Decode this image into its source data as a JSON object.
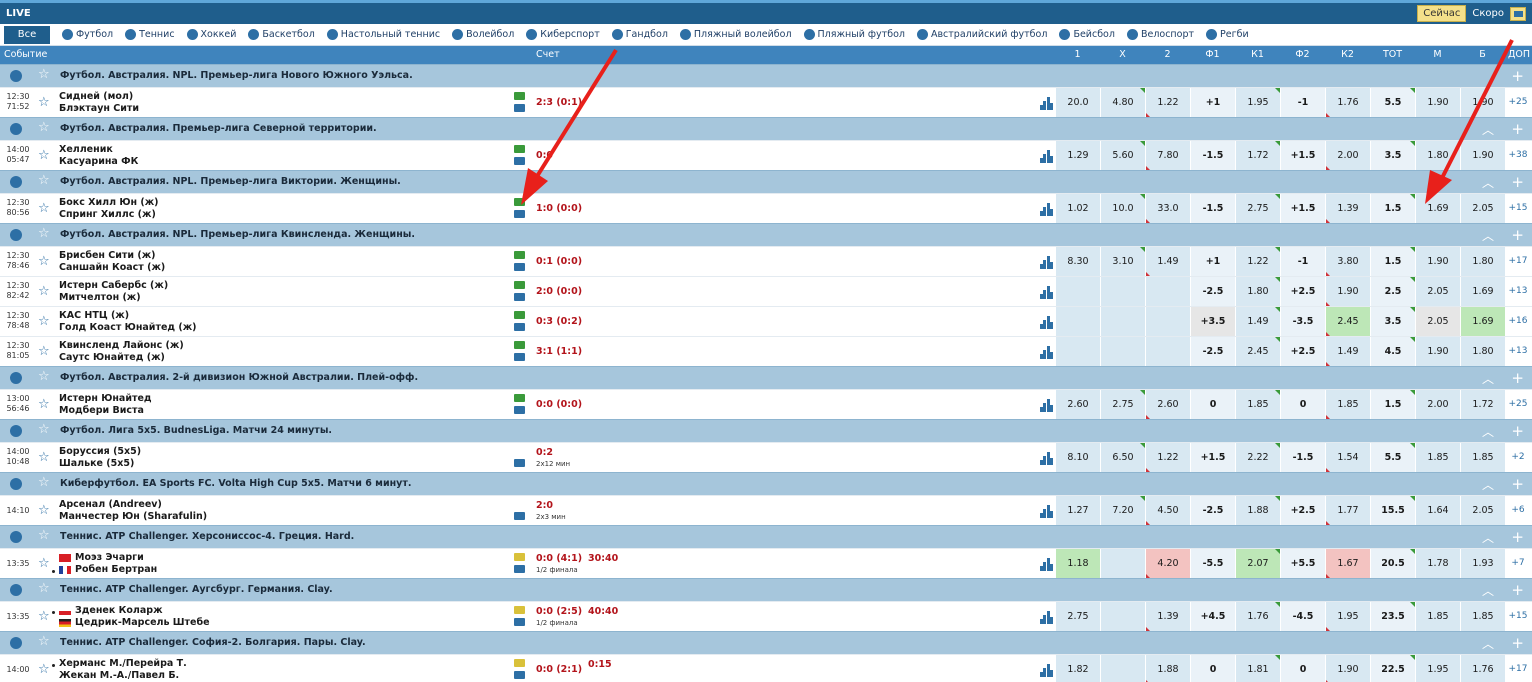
{
  "topbar": {
    "live": "LIVE",
    "now": "Сейчас",
    "soon": "Скоро"
  },
  "sports": {
    "all": "Все",
    "items": [
      "Футбол",
      "Теннис",
      "Хоккей",
      "Баскетбол",
      "Настольный теннис",
      "Волейбол",
      "Киберспорт",
      "Гандбол",
      "Пляжный волейбол",
      "Пляжный футбол",
      "Австралийский футбол",
      "Бейсбол",
      "Велоспорт",
      "Регби"
    ]
  },
  "header": {
    "event": "Событие",
    "score": "Счет",
    "c1": "1",
    "cx": "X",
    "c2": "2",
    "f1": "Ф1",
    "k1": "К1",
    "f2": "Ф2",
    "k2": "К2",
    "tot": "ТОТ",
    "m": "М",
    "b": "Б",
    "dop": "ДОП"
  },
  "colors": {
    "accent": "#1f5e8c",
    "score": "#b3141b",
    "league": "#a6c6dc",
    "arrow": "#e8201b"
  },
  "leagues": [
    {
      "name": "Футбол. Австралия. NPL. Премьер-лига Нового Южного Уэльса.",
      "rows": [
        {
          "t": "12:30",
          "m": "71:52",
          "a": "Сидней (мол)",
          "b": "Блэктаун Сити",
          "sc": "2:3 (0:1)",
          "odds": [
            "20.0",
            "4.80",
            "1.22",
            "+1",
            "1.95",
            "-1",
            "1.76",
            "5.5",
            "1.90",
            "1.90"
          ],
          "more": "+25"
        }
      ]
    },
    {
      "name": "Футбол. Австралия. Премьер-лига Северной территории.",
      "rows": [
        {
          "t": "14:00",
          "m": "05:47",
          "a": "Хелленик",
          "b": "Касуарина ФК",
          "sc": "0:0",
          "odds": [
            "1.29",
            "5.60",
            "7.80",
            "-1.5",
            "1.72",
            "+1.5",
            "2.00",
            "3.5",
            "1.80",
            "1.90"
          ],
          "more": "+38"
        }
      ]
    },
    {
      "name": "Футбол. Австралия. NPL. Премьер-лига Виктории. Женщины.",
      "rows": [
        {
          "t": "12:30",
          "m": "80:56",
          "a": "Бокс Хилл Юн (ж)",
          "b": "Спринг Хиллс (ж)",
          "sc": "1:0 (0:0)",
          "odds": [
            "1.02",
            "10.0",
            "33.0",
            "-1.5",
            "2.75",
            "+1.5",
            "1.39",
            "1.5",
            "1.69",
            "2.05"
          ],
          "more": "+15"
        }
      ]
    },
    {
      "name": "Футбол. Австралия. NPL. Премьер-лига Квинсленда. Женщины.",
      "rows": [
        {
          "t": "12:30",
          "m": "78:46",
          "a": "Брисбен Сити (ж)",
          "b": "Саншайн Коаст (ж)",
          "sc": "0:1 (0:0)",
          "odds": [
            "8.30",
            "3.10",
            "1.49",
            "+1",
            "1.22",
            "-1",
            "3.80",
            "1.5",
            "1.90",
            "1.80"
          ],
          "more": "+17"
        },
        {
          "t": "12:30",
          "m": "82:42",
          "a": "Истерн Сабербс (ж)",
          "b": "Митчелтон (ж)",
          "sc": "2:0 (0:0)",
          "odds": [
            "",
            "",
            "",
            "-2.5",
            "1.80",
            "+2.5",
            "1.90",
            "2.5",
            "2.05",
            "1.69"
          ],
          "more": "+13"
        },
        {
          "t": "12:30",
          "m": "78:48",
          "a": "КАС НТЦ (ж)",
          "b": "Голд Коаст Юнайтед (ж)",
          "sc": "0:3 (0:2)",
          "odds": [
            "",
            "",
            "",
            "+3.5",
            "1.49",
            "-3.5",
            "2.45",
            "3.5",
            "2.05",
            "1.69"
          ],
          "more": "+16"
        },
        {
          "t": "12:30",
          "m": "81:05",
          "a": "Квинсленд Лайонс (ж)",
          "b": "Саутс Юнайтед (ж)",
          "sc": "3:1 (1:1)",
          "odds": [
            "",
            "",
            "",
            "-2.5",
            "2.45",
            "+2.5",
            "1.49",
            "4.5",
            "1.90",
            "1.80"
          ],
          "more": "+13"
        }
      ]
    },
    {
      "name": "Футбол. Австралия. 2-й дивизион Южной Австралии. Плей-офф.",
      "rows": [
        {
          "t": "13:00",
          "m": "56:46",
          "a": "Истерн Юнайтед",
          "b": "Модбери Виста",
          "sc": "0:0 (0:0)",
          "odds": [
            "2.60",
            "2.75",
            "2.60",
            "0",
            "1.85",
            "0",
            "1.85",
            "1.5",
            "2.00",
            "1.72"
          ],
          "more": "+25"
        }
      ]
    },
    {
      "name": "Футбол. Лига 5х5. BudnesLiga. Матчи 24 минуты.",
      "rows": [
        {
          "t": "14:00",
          "m": "10:48",
          "a": "Боруссия (5х5)",
          "b": "Шальке (5х5)",
          "sc": "0:2",
          "sub": "2х12 мин",
          "odds": [
            "8.10",
            "6.50",
            "1.22",
            "+1.5",
            "2.22",
            "-1.5",
            "1.54",
            "5.5",
            "1.85",
            "1.85"
          ],
          "more": "+2"
        }
      ]
    },
    {
      "name": "Киберфутбол. EA Sports FC. Volta High Cup 5x5. Матчи 6 минут.",
      "rows": [
        {
          "t": "14:10",
          "m": "",
          "a": "Арсенал (Andreev)",
          "b": "Манчестер Юн (Sharafulin)",
          "sc": "2:0",
          "sub": "2х3 мин",
          "odds": [
            "1.27",
            "7.20",
            "4.50",
            "-2.5",
            "1.88",
            "+2.5",
            "1.77",
            "15.5",
            "1.64",
            "2.05"
          ],
          "more": "+6"
        }
      ]
    },
    {
      "name": "Теннис. ATP Challenger. Херсониссос-4. Греция. Hard.",
      "rows": [
        {
          "t": "13:35",
          "m": "",
          "a": "Моэз Эчарги",
          "b": "Робен Бертран",
          "sc": "0:0 (4:1)",
          "game": "30:40",
          "sub": "1/2 финала",
          "odds": [
            "1.18",
            "",
            "4.20",
            "-5.5",
            "2.07",
            "+5.5",
            "1.67",
            "20.5",
            "1.78",
            "1.93"
          ],
          "more": "+7"
        }
      ]
    },
    {
      "name": "Теннис. ATP Challenger. Аугсбург. Германия. Clay.",
      "rows": [
        {
          "t": "13:35",
          "m": "",
          "a": "Зденек Коларж",
          "b": "Цедрик-Марсель Штебе",
          "sc": "0:0 (2:5)",
          "game": "40:40",
          "sub": "1/2 финала",
          "odds": [
            "2.75",
            "",
            "1.39",
            "+4.5",
            "1.76",
            "-4.5",
            "1.95",
            "23.5",
            "1.85",
            "1.85"
          ],
          "more": "+15"
        }
      ]
    },
    {
      "name": "Теннис. ATP Challenger. София-2. Болгария. Пары. Clay.",
      "rows": [
        {
          "t": "14:00",
          "m": "",
          "a": "Херманс М./Перейра Т.",
          "b": "Жекан М.-А./Павел Б.",
          "sc": "0:0 (2:1)",
          "game": "0:15",
          "sub": "",
          "odds": [
            "1.82",
            "",
            "1.88",
            "0",
            "1.81",
            "0",
            "1.90",
            "22.5",
            "1.95",
            "1.76"
          ],
          "more": "+17"
        }
      ]
    }
  ]
}
